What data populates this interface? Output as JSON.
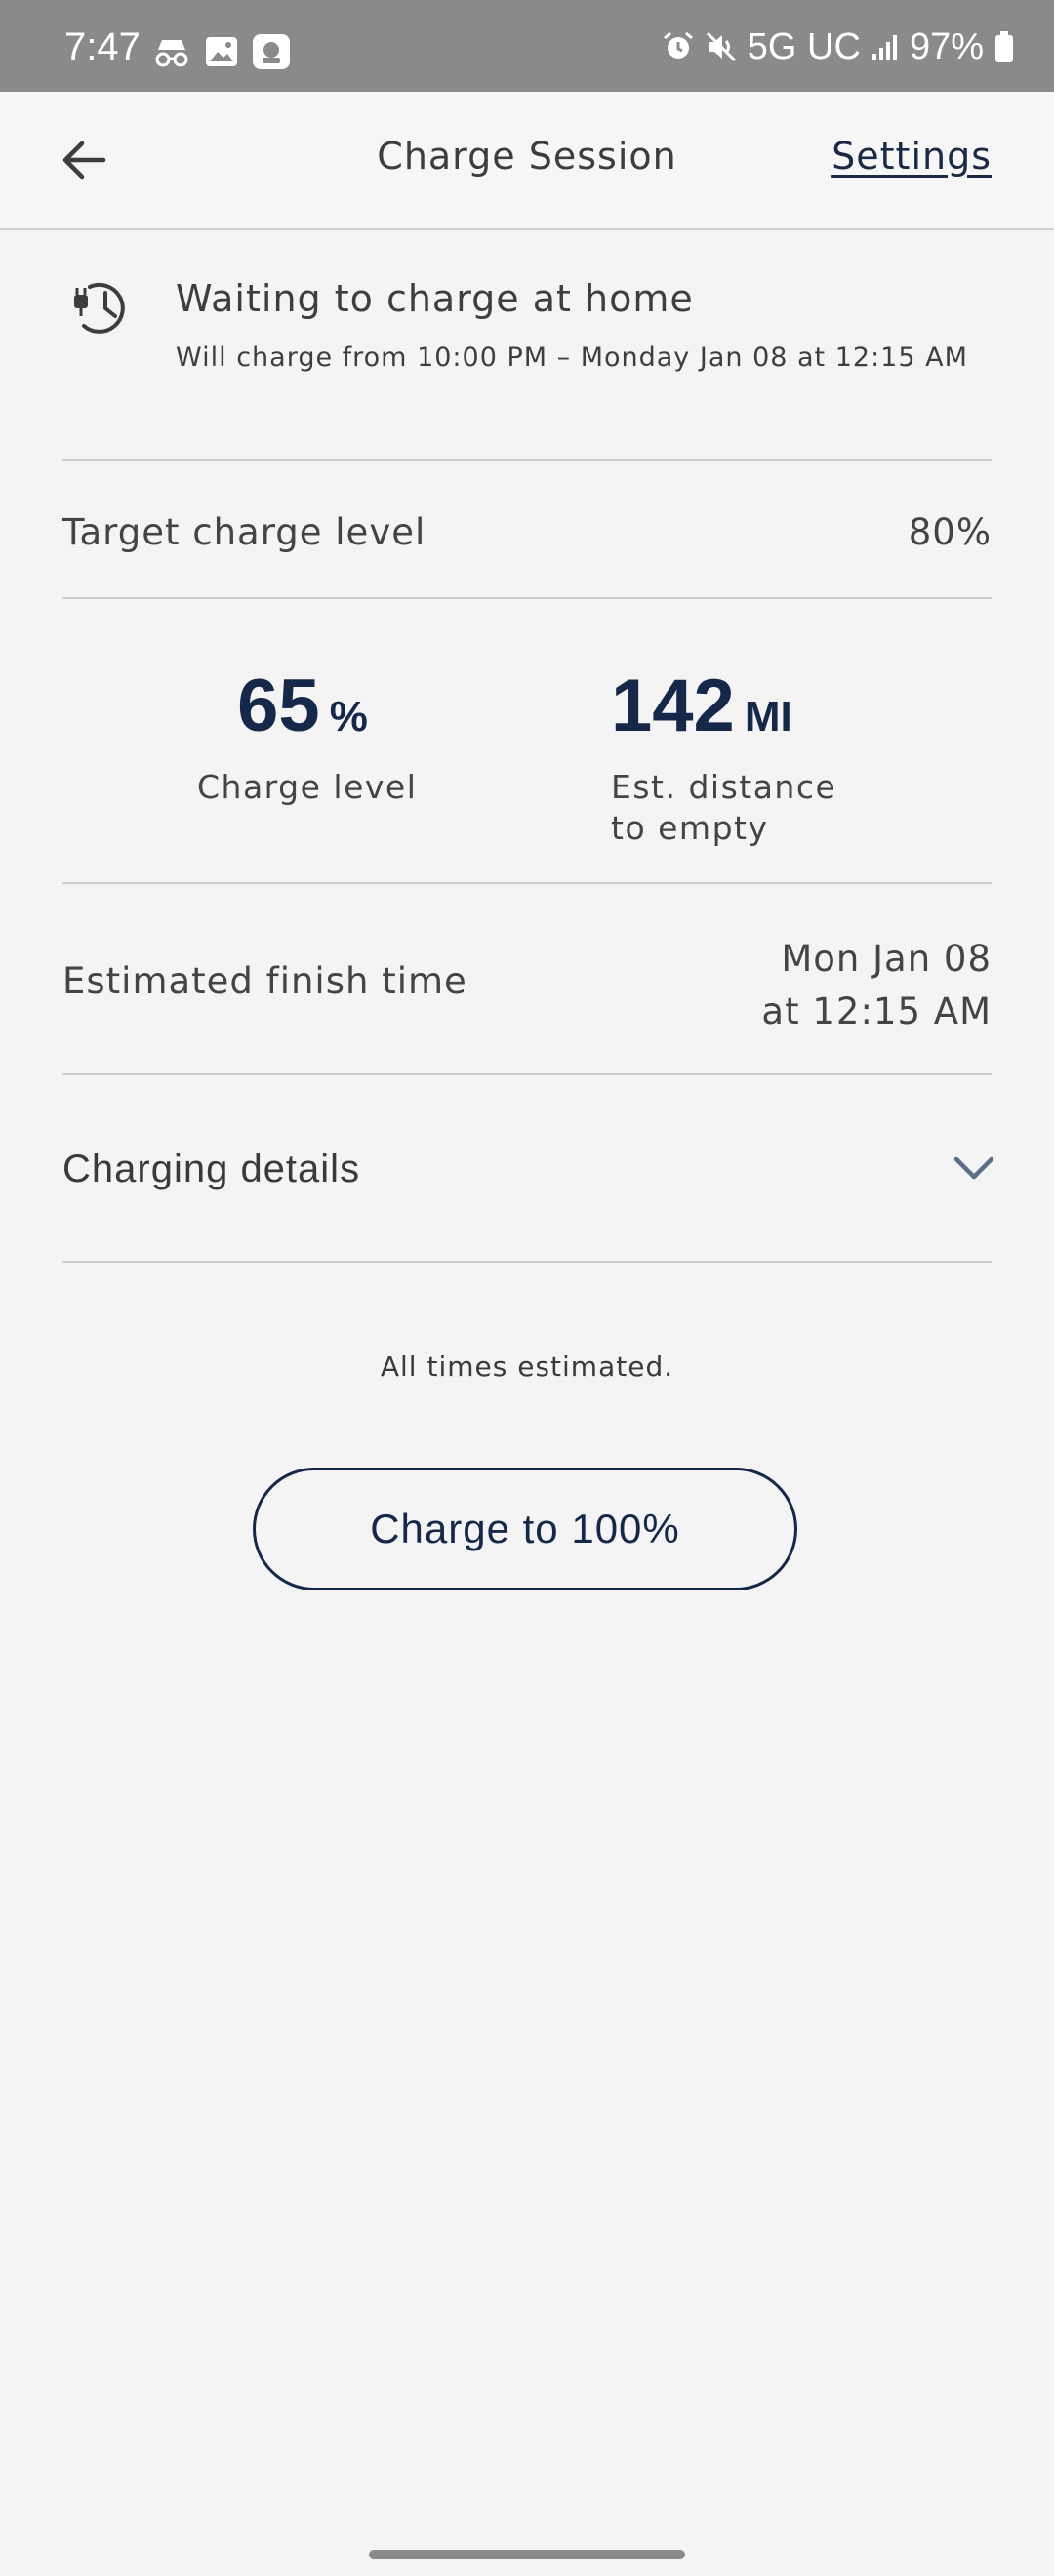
{
  "status_bar": {
    "time": "7:47",
    "network": "5G UC",
    "battery": "97%"
  },
  "header": {
    "title": "Charge Session",
    "settings_label": "Settings"
  },
  "waiting": {
    "title": "Waiting to charge at home",
    "subtitle": "Will charge from 10:00 PM – Monday Jan 08 at 12:15 AM"
  },
  "target": {
    "label": "Target charge level",
    "value": "80%"
  },
  "stats": {
    "charge": {
      "value": "65",
      "unit": "%",
      "label": "Charge level"
    },
    "distance": {
      "value": "142",
      "unit": "MI",
      "label_line1": "Est. distance",
      "label_line2": "to empty"
    }
  },
  "finish": {
    "label": "Estimated finish time",
    "value_line1": "Mon Jan 08",
    "value_line2": "at 12:15 AM"
  },
  "details": {
    "label": "Charging details"
  },
  "footnote": "All times estimated.",
  "charge_button": "Charge to 100%"
}
